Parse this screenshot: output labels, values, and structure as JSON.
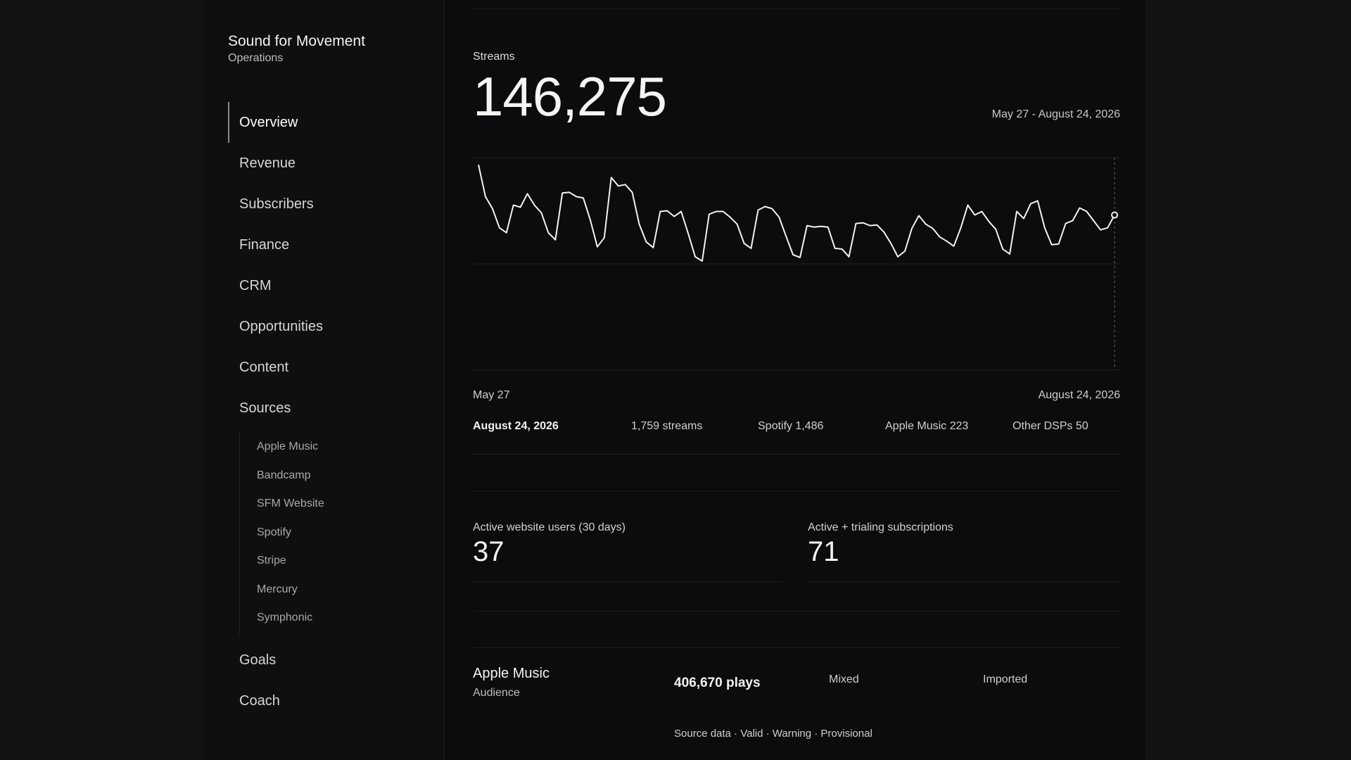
{
  "brand": {
    "title": "Sound for Movement",
    "subtitle": "Operations"
  },
  "nav": {
    "items": [
      "Overview",
      "Revenue",
      "Subscribers",
      "Finance",
      "CRM",
      "Opportunities",
      "Content",
      "Sources"
    ],
    "active": "Overview",
    "sources": [
      "Apple Music",
      "Bandcamp",
      "SFM Website",
      "Spotify",
      "Stripe",
      "Mercury",
      "Symphonic"
    ],
    "bottom": [
      "Goals",
      "Coach"
    ]
  },
  "streams": {
    "label": "Streams",
    "total": "146,275",
    "range": "May 27 - August 24, 2026",
    "axis_start": "May 27",
    "axis_end": "August 24, 2026"
  },
  "selected": {
    "date": "August 24, 2026",
    "streams": "1,759 streams",
    "spotify": "Spotify 1,486",
    "apple": "Apple Music 223",
    "other": "Other DSPs 50"
  },
  "kpis": {
    "users_label": "Active website users (30 days)",
    "users_value": "37",
    "subs_label": "Active + trialing subscriptions",
    "subs_value": "71"
  },
  "source_card": {
    "title": "Apple Music",
    "subtitle": "Audience",
    "plays": "406,670 plays",
    "mix": "Mixed",
    "status": "Imported",
    "note": "Source data · Valid · Warning · Provisional"
  },
  "colors": {
    "background": "#0b0c0e",
    "line": "#f2f2f2",
    "muted": "#a9a9a9"
  },
  "chart_data": {
    "type": "line",
    "x_start": "May 27",
    "x_end": "August 24, 2026",
    "series": [
      {
        "values": [
          2900,
          2450,
          2280,
          2010,
          1940,
          2330,
          2300,
          2490,
          2330,
          2220,
          1940,
          1840,
          2500,
          2510,
          2450,
          2430,
          2120,
          1740,
          1870,
          2720,
          2600,
          2620,
          2510,
          2060,
          1810,
          1730,
          2240,
          2250,
          2170,
          2240,
          1930,
          1600,
          1540,
          2200,
          2240,
          2240,
          2160,
          2060,
          1790,
          1720,
          2260,
          2310,
          2280,
          2160,
          1890,
          1630,
          1590,
          2040,
          2020,
          2030,
          2020,
          1720,
          1710,
          1600,
          2070,
          2080,
          2040,
          2050,
          1950,
          1790,
          1600,
          1680,
          2000,
          2180,
          2060,
          2000,
          1880,
          1820,
          1750,
          2010,
          2330,
          2190,
          2240,
          2100,
          1990,
          1710,
          1640,
          2240,
          2140,
          2350,
          2390,
          2010,
          1770,
          1780,
          2070,
          2110,
          2290,
          2240,
          2110,
          1980,
          2010,
          2190
        ]
      }
    ],
    "ylim": [
      0,
      3000
    ],
    "grid": true,
    "highlight_last": true
  }
}
